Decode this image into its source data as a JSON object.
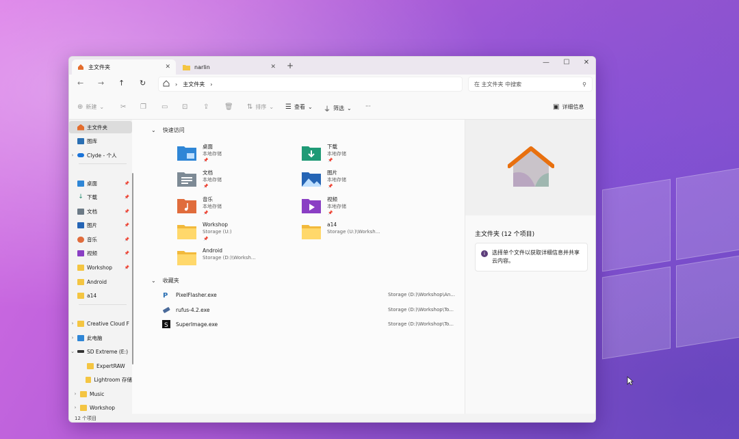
{
  "tabs": [
    {
      "label": "主文件夹",
      "active": true
    },
    {
      "label": "narlin",
      "active": false
    }
  ],
  "window_controls": {
    "minimize": "—",
    "maximize": "☐",
    "close": "✕"
  },
  "address": {
    "home_icon": "home-icon",
    "separator": "›",
    "path": "主文件夹",
    "trailing": "›"
  },
  "search": {
    "placeholder": "在 主文件夹 中搜索"
  },
  "toolbar": {
    "new_label": "新建",
    "sort_label": "排序",
    "view_label": "查看",
    "filter_label": "筛选",
    "more_label": "···",
    "details_label": "详细信息"
  },
  "sidebar": {
    "items": [
      {
        "label": "主文件夹",
        "icon": "home-icon",
        "color": "#e36d2d"
      },
      {
        "label": "图库",
        "icon": "gallery-icon",
        "color": "#2a6fb3"
      },
      {
        "label": "Clyde - 个人",
        "icon": "cloud-icon",
        "color": "#1a73d8"
      },
      {
        "label": "桌面",
        "icon": "desktop-icon",
        "color": "#2f86d6"
      },
      {
        "label": "下载",
        "icon": "download-icon",
        "color": "#1f8a6b"
      },
      {
        "label": "文档",
        "icon": "document-icon",
        "color": "#6c7a86"
      },
      {
        "label": "图片",
        "icon": "picture-icon",
        "color": "#2565b5"
      },
      {
        "label": "音乐",
        "icon": "music-icon",
        "color": "#e06c3c"
      },
      {
        "label": "视频",
        "icon": "video-icon",
        "color": "#8a3fc4"
      },
      {
        "label": "Workshop",
        "icon": "folder-icon",
        "color": "#f4c542"
      },
      {
        "label": "Android",
        "icon": "folder-icon",
        "color": "#f4c542"
      },
      {
        "label": "a14",
        "icon": "folder-icon",
        "color": "#f4c542"
      },
      {
        "label": "Creative Cloud F",
        "icon": "creative-cloud-icon",
        "color": "#f4c542"
      },
      {
        "label": "此电脑",
        "icon": "computer-icon",
        "color": "#2f86d6"
      },
      {
        "label": "SD Extreme (E:)",
        "icon": "drive-icon",
        "color": "#333333"
      },
      {
        "label": "ExpertRAW",
        "icon": "folder-icon",
        "color": "#f4c542"
      },
      {
        "label": "Lightroom 存储",
        "icon": "folder-icon",
        "color": "#f4c542"
      },
      {
        "label": "Music",
        "icon": "folder-icon",
        "color": "#f4c542"
      },
      {
        "label": "Workshop",
        "icon": "folder-icon",
        "color": "#f4c542"
      }
    ]
  },
  "status": {
    "count": "12 个项目"
  },
  "quick_access": {
    "heading": "快速访问",
    "items": [
      {
        "name": "桌面",
        "sub": "本地存储",
        "icon": "desktop-folder-icon",
        "color": "#2f86d6"
      },
      {
        "name": "下载",
        "sub": "本地存储",
        "icon": "download-folder-icon",
        "color": "#1f9a76"
      },
      {
        "name": "文档",
        "sub": "本地存储",
        "icon": "document-folder-icon",
        "color": "#6c7a86"
      },
      {
        "name": "图片",
        "sub": "本地存储",
        "icon": "picture-folder-icon",
        "color": "#2565b5"
      },
      {
        "name": "音乐",
        "sub": "本地存储",
        "icon": "music-folder-icon",
        "color": "#e06c3c"
      },
      {
        "name": "视频",
        "sub": "本地存储",
        "icon": "video-folder-icon",
        "color": "#8a3fc4"
      },
      {
        "name": "Workshop",
        "sub": "Storage (U:)",
        "icon": "folder-icon",
        "color": "#f4c542"
      },
      {
        "name": "a14",
        "sub": "Storage (U:)\\Worksh...",
        "icon": "folder-icon",
        "color": "#f4c542"
      },
      {
        "name": "Android",
        "sub": "Storage (D:)\\Worksh...",
        "icon": "folder-icon",
        "color": "#f4c542"
      }
    ]
  },
  "favorites": {
    "heading": "收藏夹",
    "items": [
      {
        "name": "PixelFlasher.exe",
        "path": "Storage (D:)\\Workshop\\An...",
        "icon": "pixelflasher-icon"
      },
      {
        "name": "rufus-4.2.exe",
        "path": "Storage (D:)\\Workshop\\To...",
        "icon": "rufus-icon"
      },
      {
        "name": "SuperImage.exe",
        "path": "Storage (D:)\\Workshop\\To...",
        "icon": "superimage-icon"
      }
    ]
  },
  "details": {
    "title": "主文件夹 (12 个项目)",
    "info": "选择单个文件以获取详细信息并共享云内容。",
    "preview_icon": "home-large-icon"
  }
}
